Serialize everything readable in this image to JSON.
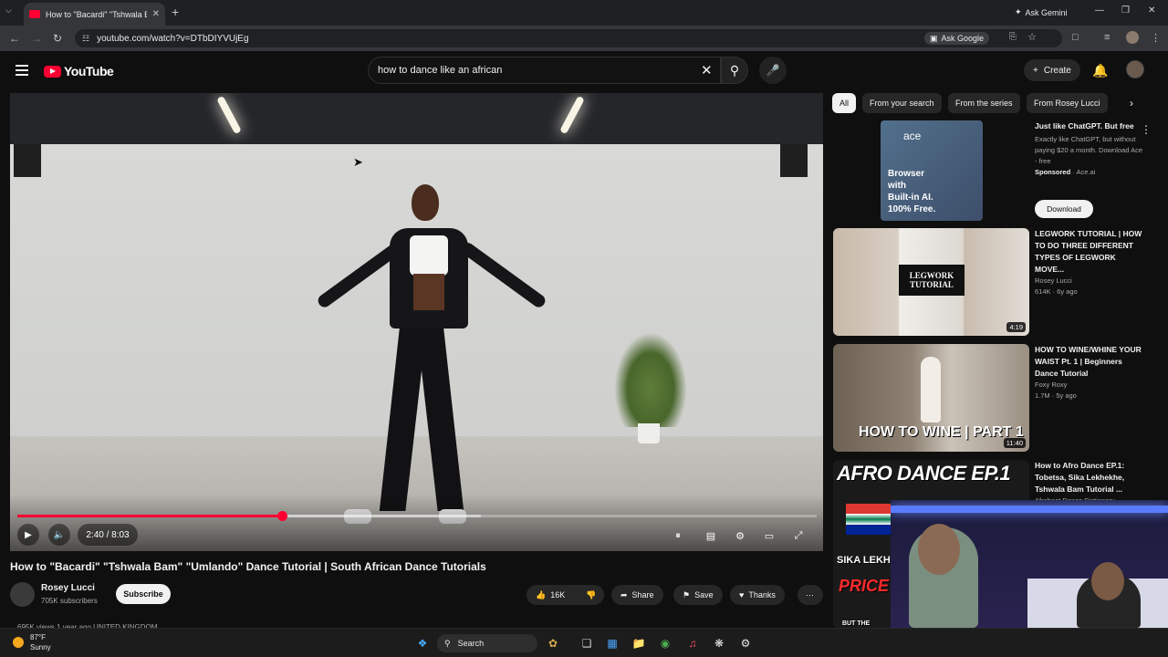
{
  "browser": {
    "tab_title": "How to \"Bacardi\" \"Tshwala Bam\"",
    "url": "youtube.com/watch?v=DTbDIYVUjEg",
    "ask_gemini": "Ask Gemini",
    "ask_google": "Ask Google"
  },
  "youtube": {
    "logo_text": "YouTube",
    "search_query": "how to dance like an african",
    "create_label": "Create"
  },
  "player": {
    "time_display": "2:40 / 8:03",
    "progress_fraction": 0.331,
    "buffered_fraction": 0.58
  },
  "video": {
    "title": "How to \"Bacardi\" \"Tshwala Bam\" \"Umlando\" Dance Tutorial | South African Dance Tutorials",
    "channel_name": "Rosey Lucci",
    "subscribers": "705K subscribers",
    "subscribe_label": "Subscribe",
    "likes": "16K",
    "share_label": "Share",
    "save_label": "Save",
    "thanks_label": "Thanks",
    "views_line": "695K views  1 year ago  UNITED KINGDOM"
  },
  "chips": [
    "All",
    "From your search",
    "From the series",
    "From Rosey Lucci"
  ],
  "ad": {
    "brand": "ace",
    "copy": [
      "Browser",
      "with",
      "Built-in AI.",
      "100% Free."
    ],
    "title": "Just like ChatGPT. But free",
    "desc": "Exactly like ChatGPT, but without paying $20 a month. Download Ace - free",
    "sponsor_label": "Sponsored",
    "sponsor_domain": "Ace.ai",
    "cta": "Download"
  },
  "recommendations": [
    {
      "title": "LEGWORK TUTORIAL | HOW TO DO THREE DIFFERENT TYPES OF LEGWORK MOVE...",
      "channel": "Rosey Lucci",
      "stats": "614K · 6y ago",
      "duration": "4:19",
      "overlay": "LEGWORK TUTORIAL"
    },
    {
      "title": "HOW TO WINE/WHINE YOUR WAIST Pt. 1 | Beginners Dance Tutorial",
      "channel": "Foxy Roxy",
      "stats": "1.7M · 5y ago",
      "duration": "11:40",
      "overlay": "HOW TO WINE | PART 1"
    },
    {
      "title": "How to Afro Dance EP.1: Tobetsa, Sika Lekhekhe, Tshwala Bam Tutorial ...",
      "channel": "Afrobeat Dance Dictionary",
      "overlay": "AFRO DANCE EP.1",
      "overlay2": "SIKA LEKHE",
      "overlay3": "PRICE",
      "overlay4": "BUT THE"
    }
  ],
  "taskbar": {
    "temp": "87°F",
    "condition": "Sunny",
    "search": "Search"
  },
  "colors": {
    "background": "#0f0f0f",
    "accent_red": "#ff0033",
    "chip_bg": "#272727"
  },
  "icons": [
    "tabs-menu-icon",
    "back-icon",
    "forward-icon",
    "reload-icon",
    "site-info-icon",
    "search-icon",
    "mic-icon",
    "bell-icon",
    "play-icon",
    "volume-icon",
    "autoplay-icon",
    "captions-icon",
    "settings-icon",
    "miniplayer-icon",
    "fullscreen-icon",
    "like-icon",
    "dislike-icon",
    "share-icon",
    "save-icon",
    "thanks-icon",
    "more-icon",
    "windows-start-icon"
  ]
}
